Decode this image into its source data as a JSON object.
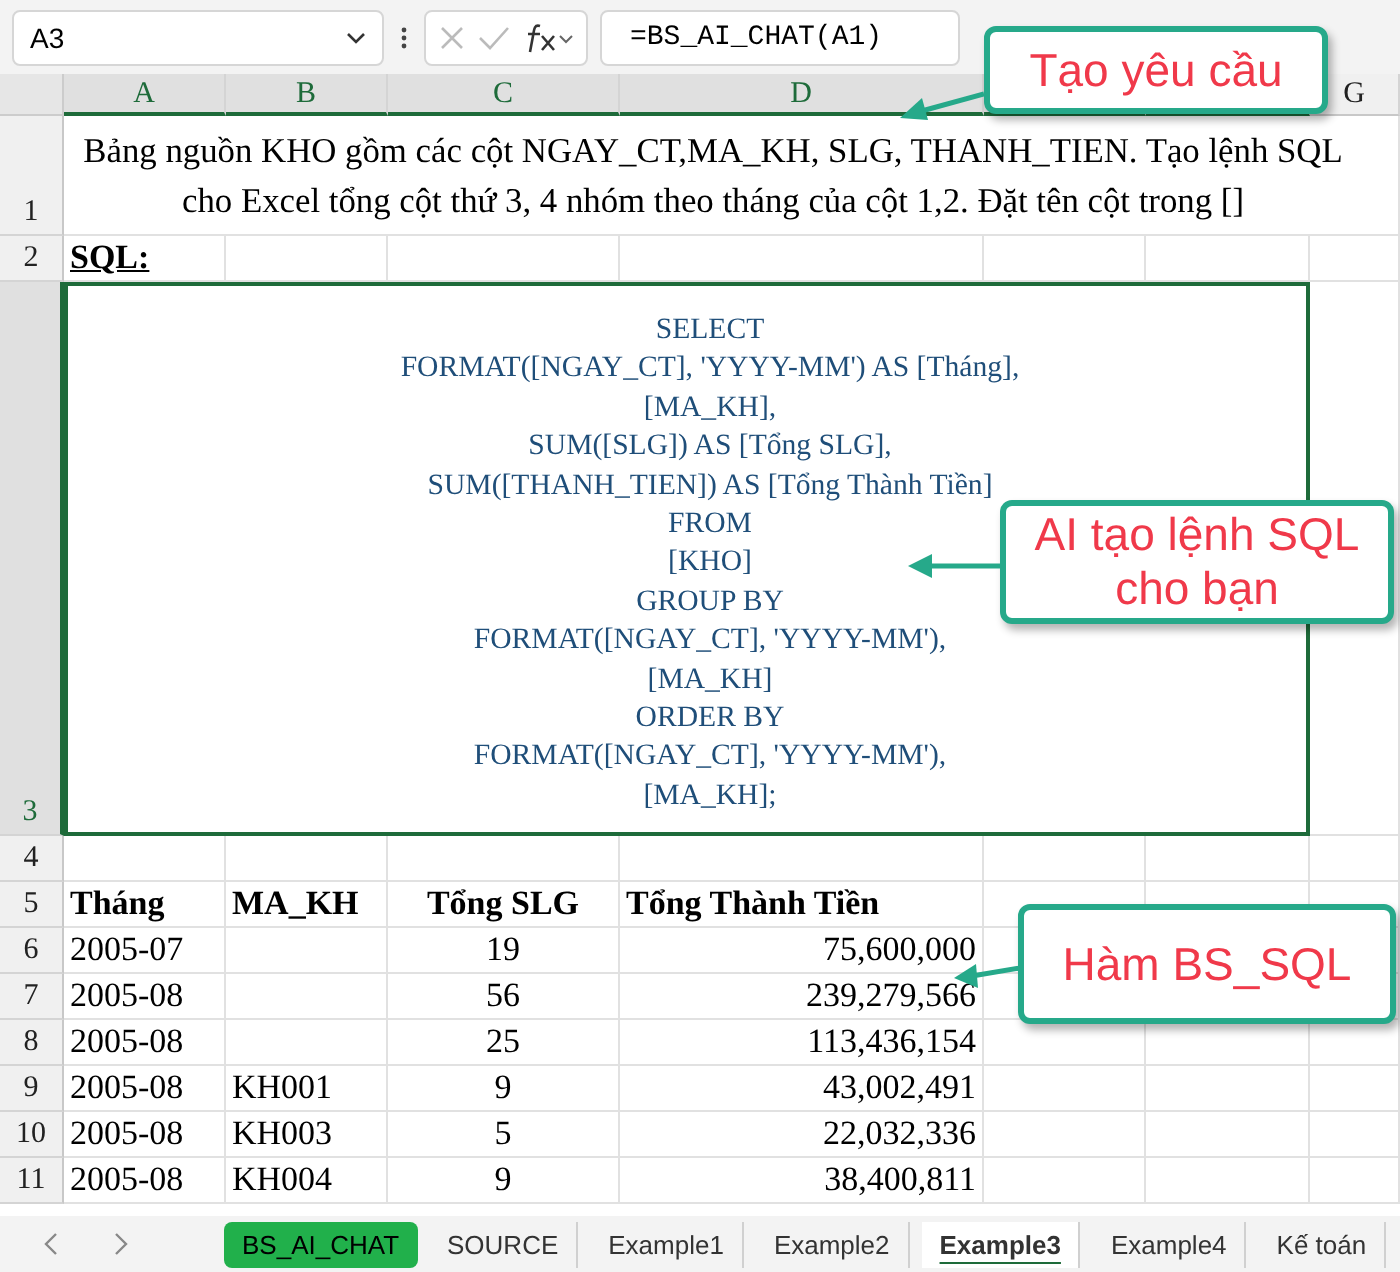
{
  "formula_bar": {
    "name_box": "A3",
    "formula": "=BS_AI_CHAT(A1)"
  },
  "columns": [
    {
      "label": "A",
      "selected": true
    },
    {
      "label": "B",
      "selected": true
    },
    {
      "label": "C",
      "selected": true
    },
    {
      "label": "D",
      "selected": true
    },
    {
      "selected": true
    },
    {
      "selected": true
    },
    {
      "label": "G",
      "selected": false
    }
  ],
  "prompt": {
    "row": "1",
    "selected": false,
    "text": "Bảng nguồn KHO gồm các cột NGAY_CT,MA_KH, SLG, THANH_TIEN. Tạo lệnh SQL cho Excel tổng cột thứ 3, 4 nhóm theo tháng của cột 1,2. Đặt tên cột trong []"
  },
  "sql_label": {
    "row": "2",
    "selected": false,
    "text": "SQL:"
  },
  "sql": {
    "row": "3",
    "selected": true,
    "lines": [
      "SELECT",
      "FORMAT([NGAY_CT], 'YYYY-MM') AS [Tháng],",
      "[MA_KH],",
      "SUM([SLG]) AS [Tổng SLG],",
      "SUM([THANH_TIEN]) AS [Tổng Thành Tiền]",
      "FROM",
      "[KHO]",
      "GROUP BY",
      "FORMAT([NGAY_CT], 'YYYY-MM'),",
      "[MA_KH]",
      "ORDER BY",
      "FORMAT([NGAY_CT], 'YYYY-MM'),",
      "[MA_KH];"
    ]
  },
  "empty_row": "4",
  "result": {
    "header_row": "5",
    "columns": [
      "Tháng",
      "MA_KH",
      "Tổng SLG",
      "Tổng Thành Tiền"
    ],
    "rows": [
      {
        "row": "6",
        "cells": [
          "2005-07",
          "",
          "19",
          "75,600,000"
        ]
      },
      {
        "row": "7",
        "cells": [
          "2005-08",
          "",
          "56",
          "239,279,566"
        ]
      },
      {
        "row": "8",
        "cells": [
          "2005-08",
          "",
          "25",
          "113,436,154"
        ]
      },
      {
        "row": "9",
        "cells": [
          "2005-08",
          "KH001",
          "9",
          "43,002,491"
        ]
      },
      {
        "row": "10",
        "cells": [
          "2005-08",
          "KH003",
          "5",
          "22,032,336"
        ]
      },
      {
        "row": "11",
        "cells": [
          "2005-08",
          "KH004",
          "9",
          "38,400,811"
        ]
      }
    ]
  },
  "callouts": [
    {
      "text": "Tạo yêu cầu"
    },
    {
      "text": "AI tạo lệnh SQL cho bạn"
    },
    {
      "text": "Hàm BS_SQL"
    }
  ],
  "sheet_tabs": [
    {
      "label": "BS_AI_CHAT",
      "selected": false,
      "color": "#21b04b"
    },
    {
      "label": "SOURCE",
      "selected": false
    },
    {
      "label": "Example1",
      "selected": false
    },
    {
      "label": "Example2",
      "selected": false
    },
    {
      "label": "Example3",
      "selected": true
    },
    {
      "label": "Example4",
      "selected": false
    },
    {
      "label": "Kế toán",
      "selected": false
    }
  ]
}
